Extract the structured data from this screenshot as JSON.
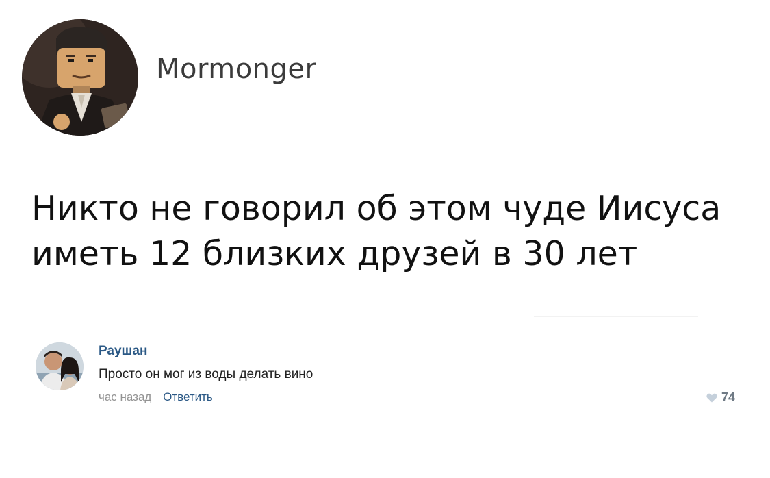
{
  "post": {
    "author": "Mormonger",
    "avatar_icon": "lego-figure-avatar",
    "text_line1": "Никто не говорил об этом чуде Иисуса",
    "text_line2": "иметь 12 близких друзей в 30 лет"
  },
  "comment": {
    "author": "Раушан",
    "avatar_icon": "couple-photo-avatar",
    "text": "Просто он мог из воды делать вино",
    "time": "час назад",
    "reply_label": "Ответить",
    "likes": "74",
    "like_icon": "heart-icon"
  },
  "colors": {
    "link": "#2a5885",
    "muted": "#939393"
  }
}
